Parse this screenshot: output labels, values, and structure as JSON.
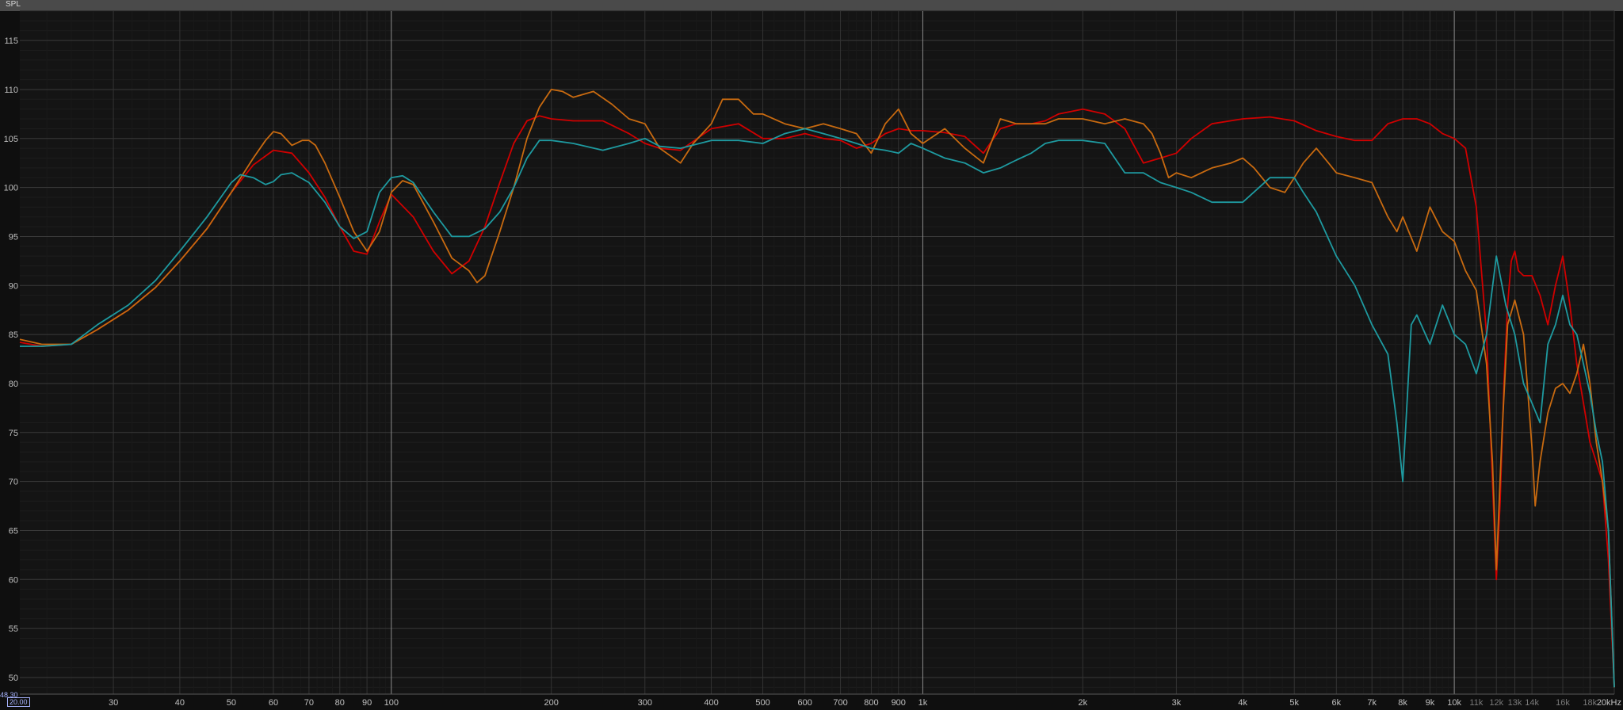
{
  "chart_data": {
    "type": "line",
    "ylabel": "SPL",
    "xlabel": "",
    "x_scale": "log",
    "xlim": [
      20,
      20000
    ],
    "ylim": [
      48.3,
      118
    ],
    "grid": true,
    "y_ticks": [
      {
        "value": 115,
        "label": "115"
      },
      {
        "value": 110,
        "label": "110"
      },
      {
        "value": 105,
        "label": "105"
      },
      {
        "value": 100,
        "label": "100"
      },
      {
        "value": 95,
        "label": "95"
      },
      {
        "value": 90,
        "label": "90"
      },
      {
        "value": 85,
        "label": "85"
      },
      {
        "value": 80,
        "label": "80"
      },
      {
        "value": 75,
        "label": "75"
      },
      {
        "value": 70,
        "label": "70"
      },
      {
        "value": 65,
        "label": "65"
      },
      {
        "value": 60,
        "label": "60"
      },
      {
        "value": 55,
        "label": "55"
      },
      {
        "value": 50,
        "label": "50"
      }
    ],
    "x_ticks": [
      {
        "value": 30,
        "label": "30"
      },
      {
        "value": 40,
        "label": "40"
      },
      {
        "value": 50,
        "label": "50"
      },
      {
        "value": 60,
        "label": "60"
      },
      {
        "value": 70,
        "label": "70"
      },
      {
        "value": 80,
        "label": "80"
      },
      {
        "value": 90,
        "label": "90"
      },
      {
        "value": 100,
        "label": "100"
      },
      {
        "value": 200,
        "label": "200"
      },
      {
        "value": 300,
        "label": "300"
      },
      {
        "value": 400,
        "label": "400"
      },
      {
        "value": 500,
        "label": "500"
      },
      {
        "value": 600,
        "label": "600"
      },
      {
        "value": 700,
        "label": "700"
      },
      {
        "value": 800,
        "label": "800"
      },
      {
        "value": 900,
        "label": "900"
      },
      {
        "value": 1000,
        "label": "1k"
      },
      {
        "value": 2000,
        "label": "2k"
      },
      {
        "value": 3000,
        "label": "3k"
      },
      {
        "value": 4000,
        "label": "4k"
      },
      {
        "value": 5000,
        "label": "5k"
      },
      {
        "value": 6000,
        "label": "6k"
      },
      {
        "value": 7000,
        "label": "7k"
      },
      {
        "value": 8000,
        "label": "8k"
      },
      {
        "value": 9000,
        "label": "9k"
      },
      {
        "value": 10000,
        "label": "10k"
      },
      {
        "value": 11000,
        "label": "11k",
        "dim": true
      },
      {
        "value": 12000,
        "label": "12k",
        "dim": true
      },
      {
        "value": 13000,
        "label": "13k",
        "dim": true
      },
      {
        "value": 14000,
        "label": "14k",
        "dim": true
      },
      {
        "value": 16000,
        "label": "16k",
        "dim": true
      },
      {
        "value": 18000,
        "label": "18k",
        "dim": true
      },
      {
        "value": 20000,
        "label": "20kHz"
      }
    ],
    "major_gridlines_x": [
      100,
      1000,
      10000
    ],
    "corner_min_label": "48.30",
    "corner_start_label": "20.00",
    "series": [
      {
        "color": "#d00000",
        "x": [
          20,
          22,
          25,
          28,
          32,
          36,
          40,
          45,
          50,
          55,
          60,
          65,
          70,
          75,
          80,
          85,
          90,
          95,
          100,
          110,
          120,
          130,
          140,
          150,
          160,
          170,
          180,
          190,
          200,
          220,
          250,
          280,
          300,
          320,
          350,
          400,
          450,
          500,
          550,
          600,
          650,
          700,
          750,
          800,
          850,
          900,
          950,
          1000,
          1100,
          1200,
          1300,
          1400,
          1500,
          1600,
          1700,
          1800,
          2000,
          2200,
          2400,
          2600,
          2800,
          3000,
          3200,
          3500,
          4000,
          4500,
          5000,
          5500,
          6000,
          6500,
          7000,
          7500,
          8000,
          8500,
          9000,
          9500,
          10000,
          10500,
          11000,
          11500,
          11800,
          12000,
          12200,
          12400,
          12600,
          12800,
          13000,
          13200,
          13500,
          14000,
          14500,
          15000,
          15500,
          16000,
          16500,
          17000,
          17500,
          18000,
          18500,
          19000,
          19500,
          20000
        ],
        "y": [
          84.2,
          83.8,
          84.0,
          85.5,
          87.5,
          89.8,
          92.5,
          95.8,
          99.5,
          102.3,
          103.8,
          103.5,
          101.5,
          99.0,
          96.0,
          93.5,
          93.2,
          96.5,
          99.3,
          97.0,
          93.5,
          91.2,
          92.5,
          96.0,
          100.5,
          104.5,
          106.8,
          107.3,
          107.0,
          106.8,
          106.8,
          105.5,
          104.5,
          104.0,
          103.8,
          106.0,
          106.5,
          105.0,
          105.0,
          105.5,
          105.0,
          104.8,
          104.0,
          104.5,
          105.5,
          106.0,
          105.8,
          105.8,
          105.6,
          105.2,
          103.5,
          106.0,
          106.5,
          106.5,
          106.8,
          107.5,
          108.0,
          107.5,
          106.0,
          102.5,
          103.0,
          103.5,
          105.0,
          106.5,
          107.0,
          107.2,
          106.8,
          105.8,
          105.2,
          104.8,
          104.8,
          106.5,
          107.0,
          107.0,
          106.5,
          105.5,
          105.0,
          104.0,
          98.0,
          85.0,
          70.0,
          60.0,
          68.0,
          80.0,
          88.0,
          92.5,
          93.5,
          91.5,
          91.0,
          91.0,
          89.0,
          86.0,
          90.0,
          93.0,
          88.0,
          82.0,
          78.0,
          74.0,
          72.0,
          70.0,
          62.0,
          49.0
        ]
      },
      {
        "color": "#c86a10",
        "x": [
          20,
          22,
          25,
          28,
          32,
          36,
          40,
          45,
          50,
          55,
          58,
          60,
          62,
          65,
          68,
          70,
          72,
          75,
          80,
          85,
          90,
          95,
          100,
          105,
          110,
          120,
          130,
          140,
          145,
          150,
          160,
          170,
          180,
          190,
          200,
          210,
          220,
          240,
          260,
          280,
          300,
          320,
          350,
          370,
          400,
          420,
          450,
          480,
          500,
          550,
          600,
          650,
          700,
          750,
          800,
          850,
          900,
          950,
          1000,
          1100,
          1200,
          1300,
          1400,
          1500,
          1600,
          1700,
          1800,
          2000,
          2200,
          2400,
          2600,
          2700,
          2800,
          2900,
          3000,
          3200,
          3500,
          3800,
          4000,
          4200,
          4500,
          4800,
          5000,
          5200,
          5500,
          5800,
          6000,
          6500,
          7000,
          7500,
          7800,
          8000,
          8500,
          9000,
          9500,
          10000,
          10500,
          11000,
          11500,
          11800,
          12000,
          12300,
          12600,
          13000,
          13500,
          14000,
          14200,
          14500,
          15000,
          15500,
          16000,
          16500,
          17000,
          17500,
          18000,
          18500,
          19000,
          19500,
          20000
        ],
        "y": [
          84.5,
          84.0,
          84.0,
          85.5,
          87.5,
          89.8,
          92.5,
          95.8,
          99.5,
          103.0,
          104.8,
          105.7,
          105.5,
          104.3,
          104.8,
          104.8,
          104.3,
          102.5,
          99.0,
          95.5,
          93.5,
          95.5,
          99.5,
          100.7,
          100.3,
          96.5,
          92.8,
          91.5,
          90.3,
          91.0,
          95.5,
          100.0,
          105.0,
          108.2,
          110.0,
          109.8,
          109.2,
          109.8,
          108.5,
          107.0,
          106.5,
          104.0,
          102.5,
          104.5,
          106.5,
          109.0,
          109.0,
          107.5,
          107.5,
          106.5,
          106.0,
          106.5,
          106.0,
          105.5,
          103.5,
          106.5,
          108.0,
          105.5,
          104.5,
          106.0,
          104.0,
          102.5,
          107.0,
          106.5,
          106.5,
          106.5,
          107.0,
          107.0,
          106.5,
          107.0,
          106.5,
          105.5,
          103.5,
          101.0,
          101.5,
          101.0,
          102.0,
          102.5,
          103.0,
          102.0,
          100.0,
          99.5,
          101.0,
          102.5,
          104.0,
          102.5,
          101.5,
          101.0,
          100.5,
          97.0,
          95.5,
          97.0,
          93.5,
          98.0,
          95.5,
          94.5,
          91.5,
          89.5,
          82.0,
          72.0,
          61.0,
          75.0,
          86.0,
          88.5,
          85.0,
          73.5,
          67.5,
          72.0,
          77.0,
          79.5,
          80.0,
          79.0,
          81.0,
          84.0,
          80.0,
          74.0,
          70.0,
          65.0,
          49.0
        ]
      },
      {
        "color": "#1e9aa0",
        "x": [
          20,
          22,
          25,
          28,
          32,
          36,
          40,
          45,
          50,
          52,
          55,
          58,
          60,
          62,
          65,
          70,
          75,
          80,
          85,
          90,
          95,
          100,
          105,
          110,
          120,
          130,
          140,
          150,
          160,
          170,
          180,
          190,
          200,
          220,
          250,
          280,
          300,
          320,
          350,
          400,
          450,
          500,
          550,
          600,
          650,
          700,
          750,
          800,
          850,
          900,
          950,
          1000,
          1100,
          1200,
          1300,
          1400,
          1500,
          1600,
          1700,
          1800,
          2000,
          2200,
          2400,
          2600,
          2800,
          3000,
          3200,
          3500,
          4000,
          4500,
          4800,
          5000,
          5200,
          5500,
          6000,
          6500,
          7000,
          7500,
          7800,
          8000,
          8300,
          8500,
          9000,
          9500,
          10000,
          10500,
          11000,
          11500,
          12000,
          12500,
          13000,
          13500,
          14000,
          14500,
          15000,
          15500,
          16000,
          16500,
          17000,
          17500,
          18000,
          18500,
          19000,
          19500,
          20000
        ],
        "y": [
          83.8,
          83.8,
          84.0,
          86.0,
          88.0,
          90.5,
          93.5,
          97.0,
          100.5,
          101.3,
          101.0,
          100.3,
          100.6,
          101.3,
          101.5,
          100.5,
          98.5,
          96.0,
          94.8,
          95.5,
          99.5,
          101.0,
          101.2,
          100.5,
          97.5,
          95.0,
          95.0,
          95.8,
          97.5,
          100.0,
          103.0,
          104.8,
          104.8,
          104.5,
          103.8,
          104.5,
          105.0,
          104.2,
          104.0,
          104.8,
          104.8,
          104.5,
          105.5,
          106.0,
          105.5,
          105.0,
          104.5,
          104.0,
          103.8,
          103.5,
          104.5,
          104.0,
          103.0,
          102.5,
          101.5,
          102.0,
          102.8,
          103.5,
          104.5,
          104.8,
          104.8,
          104.5,
          101.5,
          101.5,
          100.5,
          100.0,
          99.5,
          98.5,
          98.5,
          101.0,
          101.0,
          101.0,
          99.5,
          97.5,
          93.0,
          90.0,
          86.0,
          83.0,
          76.0,
          70.0,
          86.0,
          87.0,
          84.0,
          88.0,
          85.0,
          84.0,
          81.0,
          85.0,
          93.0,
          88.0,
          85.0,
          80.0,
          78.0,
          76.0,
          84.0,
          86.0,
          89.0,
          86.0,
          85.0,
          82.0,
          79.0,
          75.0,
          72.0,
          65.0,
          49.0
        ]
      }
    ]
  }
}
